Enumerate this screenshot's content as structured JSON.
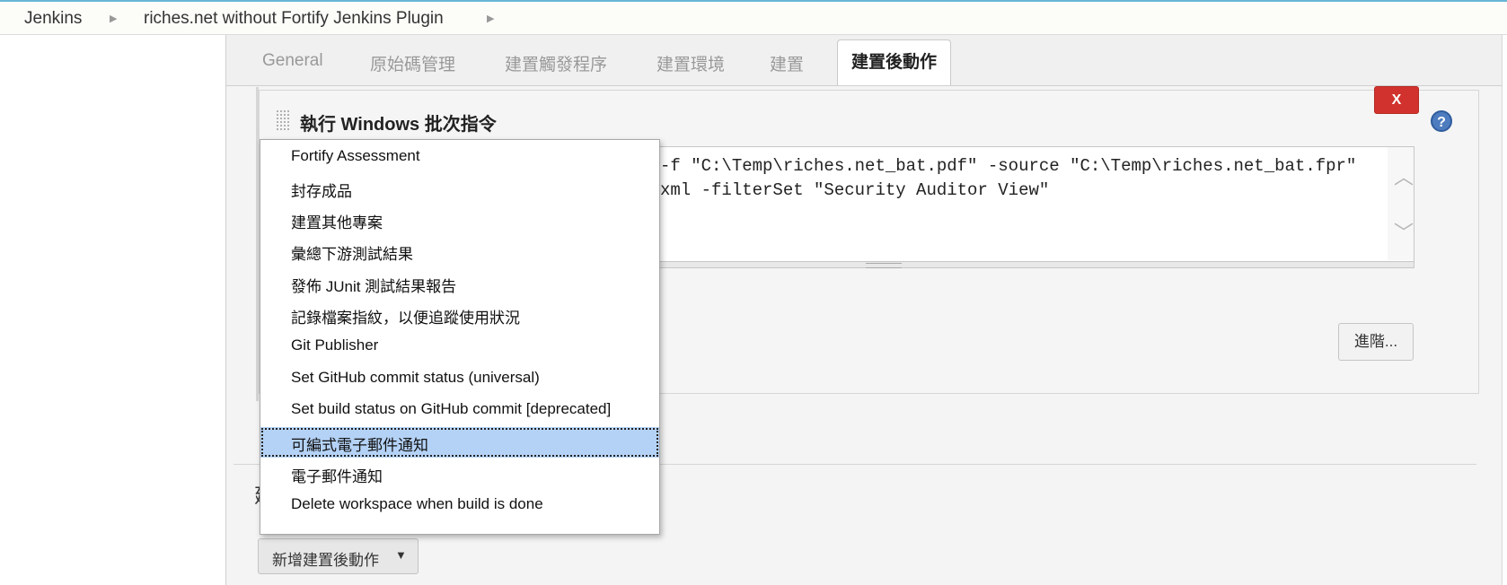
{
  "breadcrumb": {
    "items": [
      "Jenkins",
      "riches.net without Fortify Jenkins Plugin"
    ]
  },
  "tabs": [
    "General",
    "原始碼管理",
    "建置觸發程序",
    "建置環境",
    "建置",
    "建置後動作"
  ],
  "active_tab": "建置後動作",
  "build_step": {
    "title": "執行 Windows 批次指令",
    "delete_label": "X",
    "help_label": "?",
    "command_lines": [
      "-f \"C:\\Temp\\riches.net_bat.pdf\" -source \"C:\\Temp\\riches.net_bat.fpr\"",
      "xml -filterSet \"Security Auditor View\""
    ],
    "advanced_label": "進階..."
  },
  "post_build_menu": {
    "items": [
      "Fortify Assessment",
      "封存成品",
      "建置其他專案",
      "彙總下游測試結果",
      "發佈 JUnit 測試結果報告",
      "記錄檔案指紋，以便追蹤使用狀況",
      "Git Publisher",
      "Set GitHub commit status (universal)",
      "Set build status on GitHub commit [deprecated]",
      "可編式電子郵件通知",
      "電子郵件通知",
      "Delete workspace when build is done"
    ],
    "selected": "可編式電子郵件通知"
  },
  "section_letter": "建",
  "add_button": {
    "label": "新增建置後動作",
    "caret": "▼"
  },
  "colors": {
    "delete_button": "#d2322d",
    "selection": "#b4d2f6",
    "help_icon": "#4d7cbf"
  }
}
